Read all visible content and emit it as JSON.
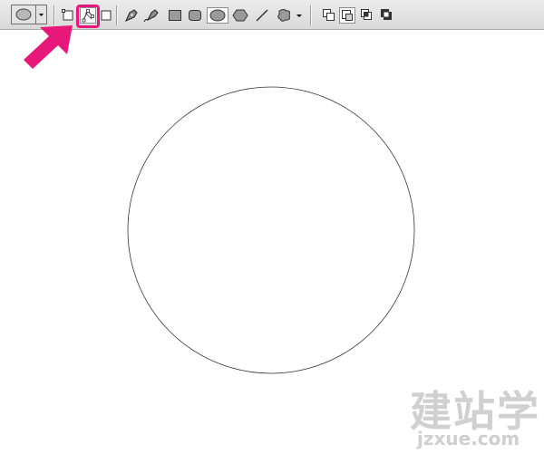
{
  "toolbar": {
    "preset_icon": "ellipse-preset-icon",
    "mode_icons": [
      "shape-layers-icon",
      "paths-icon",
      "fill-pixels-icon"
    ],
    "tool_icons": [
      "pen-icon",
      "freeform-pen-icon",
      "rectangle-icon",
      "rounded-rectangle-icon",
      "ellipse-icon",
      "polygon-icon",
      "line-icon",
      "custom-shape-icon"
    ],
    "combine_icons": [
      "add-to-area-icon",
      "subtract-from-area-icon",
      "intersect-area-icon",
      "exclude-overlap-icon"
    ],
    "highlight_color": "#e8187a"
  },
  "watermark": {
    "chinese": "建站学",
    "domain": "jzxue.com"
  }
}
